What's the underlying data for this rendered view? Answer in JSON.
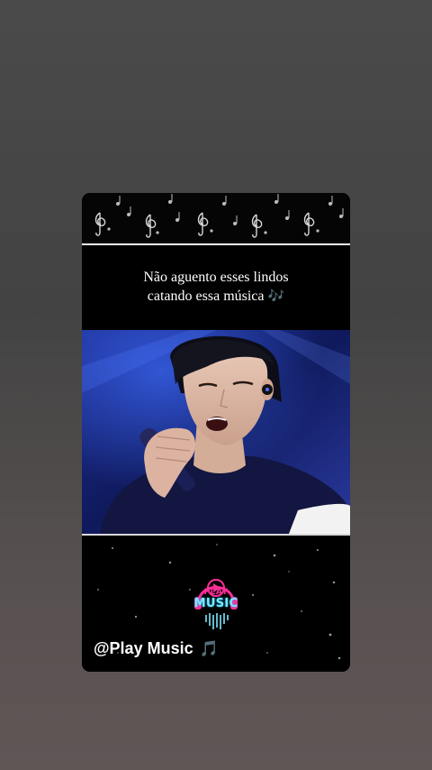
{
  "story": {
    "caption_line1": "Não aguento esses lindos",
    "caption_line2": "catando essa música",
    "caption_emoji": "🎶",
    "logo_play": "PLAY",
    "logo_music": "MUSIC",
    "handle": "@Play Music",
    "handle_emoji": "🎵",
    "header_icons": "treble-clef-icons"
  },
  "colors": {
    "background": "#4a4a4a",
    "card": "#000000",
    "caption_text": "#ffffff",
    "logo_pink": "#ff2e9a",
    "logo_cyan": "#7ee6ff",
    "video_blue": "#151a55"
  }
}
